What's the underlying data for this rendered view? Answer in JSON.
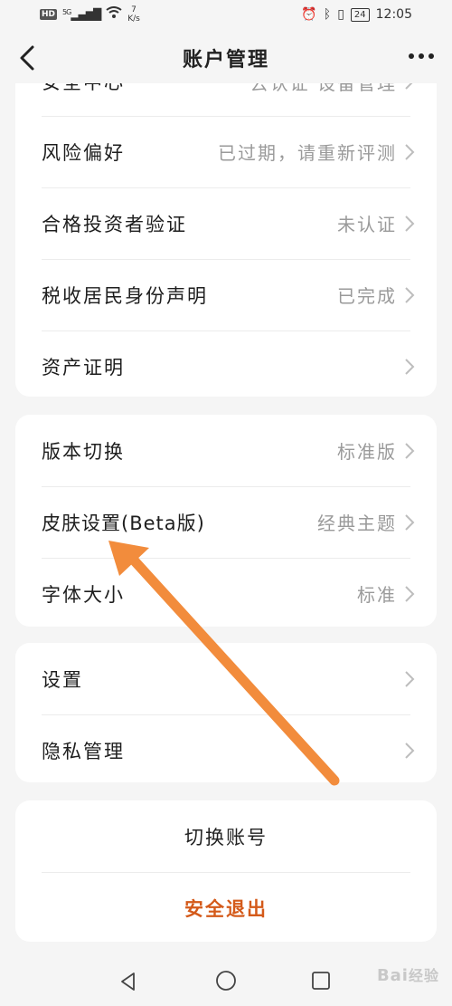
{
  "status_bar": {
    "hd": "HD",
    "network": "5G",
    "speed_value": "7",
    "speed_unit": "K/s",
    "battery": "24",
    "time": "12:05"
  },
  "header": {
    "title": "账户管理"
  },
  "group1": {
    "partial_label": "安全中心",
    "partial_value": "去认证 设备管理",
    "items": [
      {
        "label": "风险偏好",
        "value": "已过期，请重新评测"
      },
      {
        "label": "合格投资者验证",
        "value": "未认证"
      },
      {
        "label": "税收居民身份声明",
        "value": "已完成"
      },
      {
        "label": "资产证明",
        "value": ""
      }
    ]
  },
  "group2": {
    "items": [
      {
        "label": "版本切换",
        "value": "标准版"
      },
      {
        "label": "皮肤设置(Beta版)",
        "value": "经典主题"
      },
      {
        "label": "字体大小",
        "value": "标准"
      }
    ]
  },
  "group3": {
    "items": [
      {
        "label": "设置",
        "value": ""
      },
      {
        "label": "隐私管理",
        "value": ""
      }
    ]
  },
  "account": {
    "switch_label": "切换账号",
    "logout_label": "安全退出"
  },
  "watermark": {
    "brand": "Bai",
    "suffix": "经验"
  },
  "colors": {
    "background": "#f5f5f5",
    "logout": "#d45a1a",
    "annotation_arrow": "#f28c3c"
  }
}
